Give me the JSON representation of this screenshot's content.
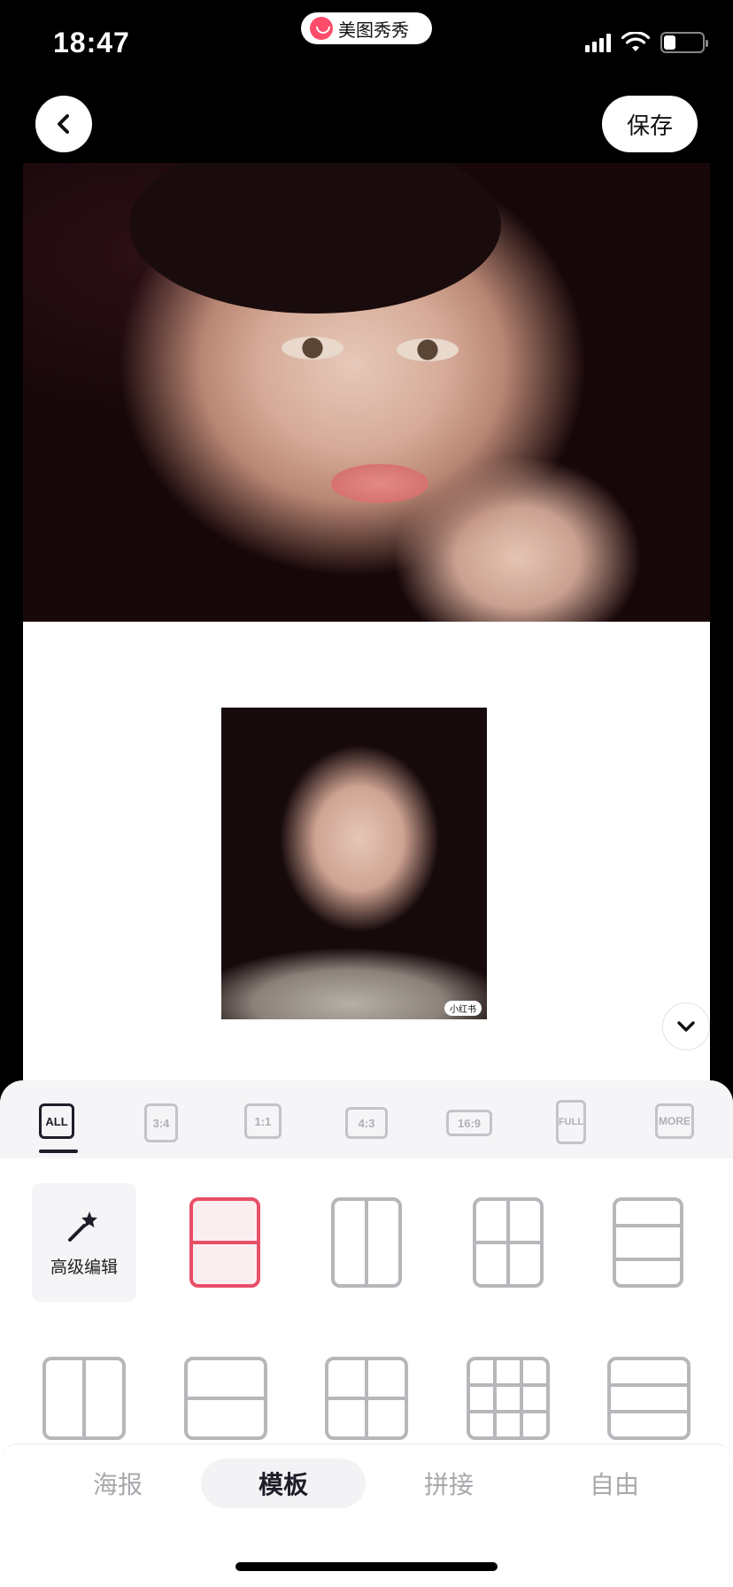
{
  "status_bar": {
    "time": "18:47",
    "app_name": "美图秀秀",
    "battery_level": 0.3
  },
  "header": {
    "back_icon": "chevron-left-icon",
    "save_label": "保存"
  },
  "canvas": {
    "watermark": "小红书"
  },
  "ratio_bar": {
    "items": [
      "ALL",
      "3:4",
      "1:1",
      "4:3",
      "16:9",
      "FULL",
      "MORE"
    ],
    "selected": "ALL"
  },
  "templates": {
    "advanced_edit_label": "高级编辑",
    "advanced_edit_icon": "magic-wand-icon",
    "accent_color": "#e84f67"
  },
  "mode_tabs": {
    "items": [
      "海报",
      "模板",
      "拼接",
      "自由"
    ],
    "selected": "模板"
  }
}
